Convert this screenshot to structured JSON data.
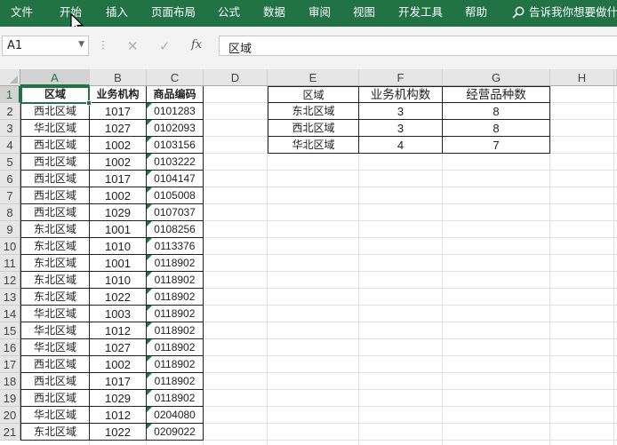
{
  "ribbon": {
    "tabs": [
      "文件",
      "开始",
      "插入",
      "页面布局",
      "公式",
      "数据",
      "审阅",
      "视图",
      "开发工具",
      "帮助"
    ],
    "tell_me": "告诉我你想要做什"
  },
  "formula_bar": {
    "name_box": "A1",
    "content": "区域"
  },
  "columns": [
    "A",
    "B",
    "C",
    "D",
    "E",
    "F",
    "G",
    "H"
  ],
  "rows": [
    "1",
    "2",
    "3",
    "4",
    "5",
    "6",
    "7",
    "8",
    "9",
    "10",
    "11",
    "12",
    "13",
    "14",
    "15",
    "16",
    "17",
    "18",
    "19",
    "20",
    "21"
  ],
  "table1": {
    "headers": [
      "区域",
      "业务机构",
      "商品编码"
    ],
    "rows": [
      [
        "西北区域",
        "1017",
        "0101283"
      ],
      [
        "华北区域",
        "1027",
        "0102093"
      ],
      [
        "西北区域",
        "1002",
        "0103156"
      ],
      [
        "西北区域",
        "1002",
        "0103222"
      ],
      [
        "西北区域",
        "1017",
        "0104147"
      ],
      [
        "西北区域",
        "1002",
        "0105008"
      ],
      [
        "西北区域",
        "1029",
        "0107037"
      ],
      [
        "东北区域",
        "1001",
        "0108256"
      ],
      [
        "东北区域",
        "1010",
        "0113376"
      ],
      [
        "东北区域",
        "1001",
        "0118902"
      ],
      [
        "东北区域",
        "1010",
        "0118902"
      ],
      [
        "东北区域",
        "1022",
        "0118902"
      ],
      [
        "华北区域",
        "1003",
        "0118902"
      ],
      [
        "华北区域",
        "1012",
        "0118902"
      ],
      [
        "华北区域",
        "1027",
        "0118902"
      ],
      [
        "西北区域",
        "1002",
        "0118902"
      ],
      [
        "西北区域",
        "1017",
        "0118902"
      ],
      [
        "西北区域",
        "1029",
        "0118902"
      ],
      [
        "华北区域",
        "1012",
        "0204080"
      ],
      [
        "东北区域",
        "1022",
        "0209022"
      ]
    ]
  },
  "table2": {
    "headers": [
      "区域",
      "业务机构数",
      "经营品种数"
    ],
    "rows": [
      [
        "东北区域",
        "3",
        "8"
      ],
      [
        "西北区域",
        "3",
        "8"
      ],
      [
        "华北区域",
        "4",
        "7"
      ]
    ]
  },
  "colors": {
    "ribbon": "#217346",
    "error_indicator": "#1e7b3a"
  }
}
